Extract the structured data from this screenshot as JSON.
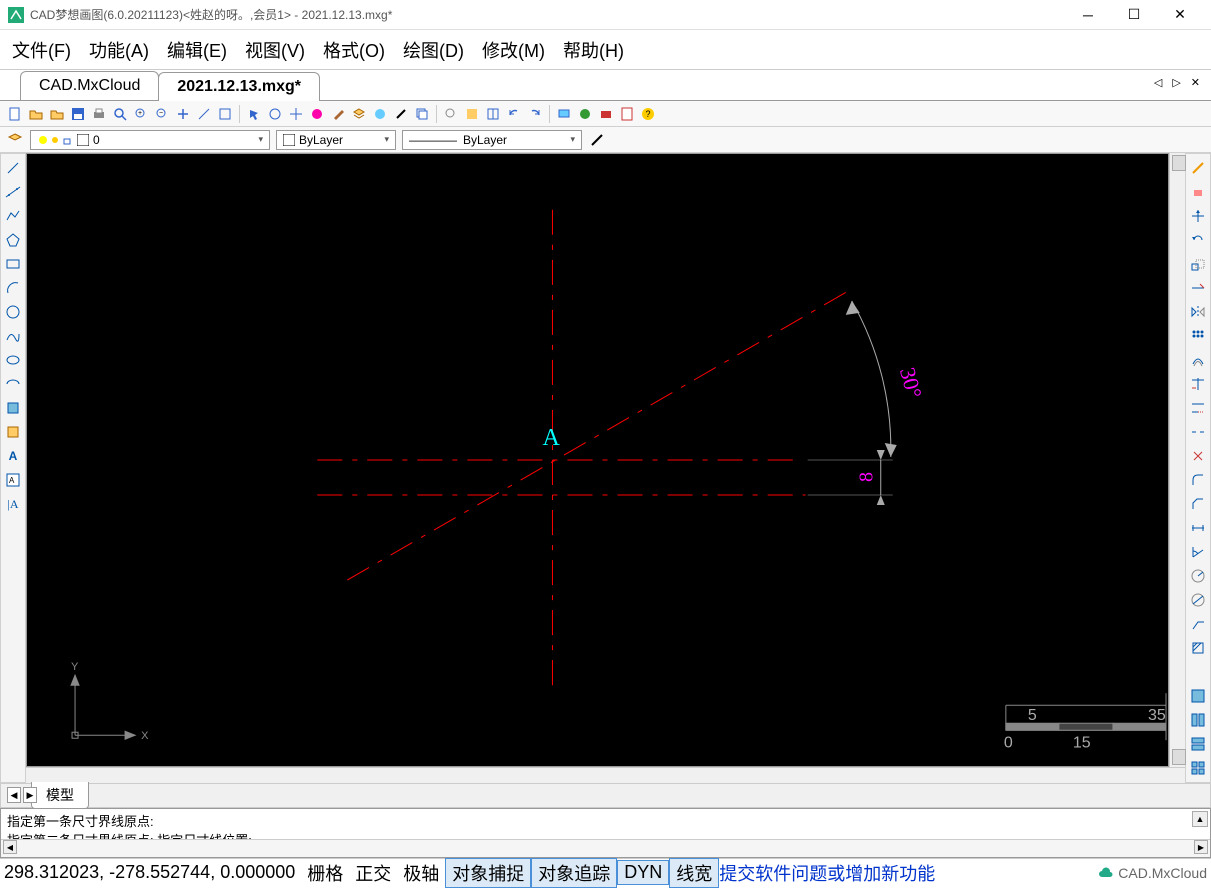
{
  "window": {
    "title": "CAD梦想画图(6.0.20211123)<姓赵的呀。,会员1> - 2021.12.13.mxg*"
  },
  "menu": {
    "file": "文件(F)",
    "func": "功能(A)",
    "edit": "编辑(E)",
    "view": "视图(V)",
    "format": "格式(O)",
    "draw": "绘图(D)",
    "modify": "修改(M)",
    "help": "帮助(H)"
  },
  "tabs": {
    "cloud": "CAD.MxCloud",
    "current": "2021.12.13.mxg*"
  },
  "layers": {
    "current": "0",
    "color": "ByLayer",
    "linetype": "ByLayer"
  },
  "drawing": {
    "label_A": "A",
    "angle": "30°",
    "dim": "8",
    "scale_left": "5",
    "scale_right": "35",
    "scale_bot_left": "0",
    "scale_bot_mid": "15",
    "axis_x": "X",
    "axis_y": "Y"
  },
  "bottom_tab": {
    "model": "模型"
  },
  "command": {
    "line1": "指定第一条尺寸界线原点:",
    "line2": "指定第二条尺寸界线原点:  指定尺寸线位置:"
  },
  "status": {
    "coords": "298.312023, -278.552744, 0.000000",
    "grid": "栅格",
    "ortho": "正交",
    "polar": "极轴",
    "osnap": "对象捕捉",
    "otrack": "对象追踪",
    "dyn": "DYN",
    "lwt": "线宽",
    "feedback": "提交软件问题或增加新功能",
    "brand": "CAD.MxCloud"
  }
}
